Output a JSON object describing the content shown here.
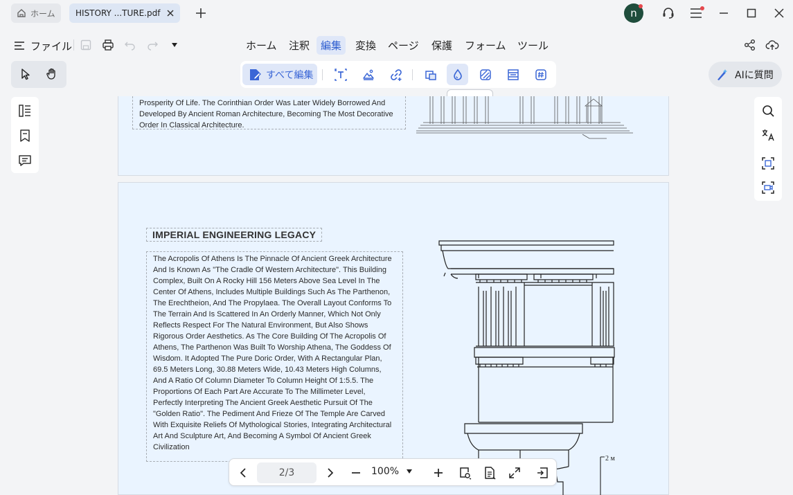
{
  "tabs": {
    "home_label": "ホーム",
    "doc_label": "HISTORY ...TURE.pdf"
  },
  "user": {
    "avatar_letter": "n"
  },
  "menu": {
    "file_label": "ファイル",
    "items": [
      "ホーム",
      "注釈",
      "編集",
      "変換",
      "ページ",
      "保護",
      "フォーム",
      "ツール"
    ],
    "active": "編集"
  },
  "edit_toolbar": {
    "edit_all_label": "すべて編集",
    "tooltip": "透かし"
  },
  "ai": {
    "label": "AIに質問"
  },
  "document": {
    "page1_text": "Prosperity Of Life. The Corinthian Order Was Later Widely Borrowed And Developed By Ancient Roman Architecture, Becoming The Most Decorative Order In Classical Architecture.",
    "page2_title": "IMPERIAL ENGINEERING LEGACY",
    "page2_body": "The Acropolis Of Athens Is The Pinnacle Of Ancient Greek Architecture And Is Known As \"The Cradle Of Western Architecture\". This Building Complex, Built On A Rocky Hill 156 Meters Above Sea Level In The Center Of Athens, Includes Multiple Buildings Such As The Parthenon, The Erechtheion, And The Propylaea. The Overall Layout Conforms To The Terrain And Is Scattered In An Orderly Manner, Which Not Only Reflects Respect For The Natural Environment, But Also Shows Rigorous Order Aesthetics. As The Core Building Of The Acropolis Of Athens, The Parthenon Was Built To Worship Athena, The Goddess Of Wisdom. It Adopted The Pure Doric Order, With A Rectangular Plan, 69.5 Meters Long, 30.88 Meters Wide, 10.43 Meters High Columns, And A Ratio Of Column Diameter To Column Height Of 1:5.5. The Proportions Of Each Part Are Accurate To The Millimeter Level, Perfectly Interpreting The Ancient Greek Aesthetic Pursuit Of The \"Golden Ratio\". The Pediment And Frieze Of The Temple Are Carved With Exquisite Reliefs Of Mythological Stories, Integrating Architectural Art And Sculpture Art, And Becoming A Symbol Of Ancient Greek Civilization",
    "drawing_label": "2 м"
  },
  "bottom": {
    "page_indicator": "2/3",
    "zoom": "100%"
  },
  "colors": {
    "accent": "#3a66d6",
    "page_bg": "#eaf4ff",
    "avatar": "#1f4d3c",
    "notify": "#e5484d"
  }
}
